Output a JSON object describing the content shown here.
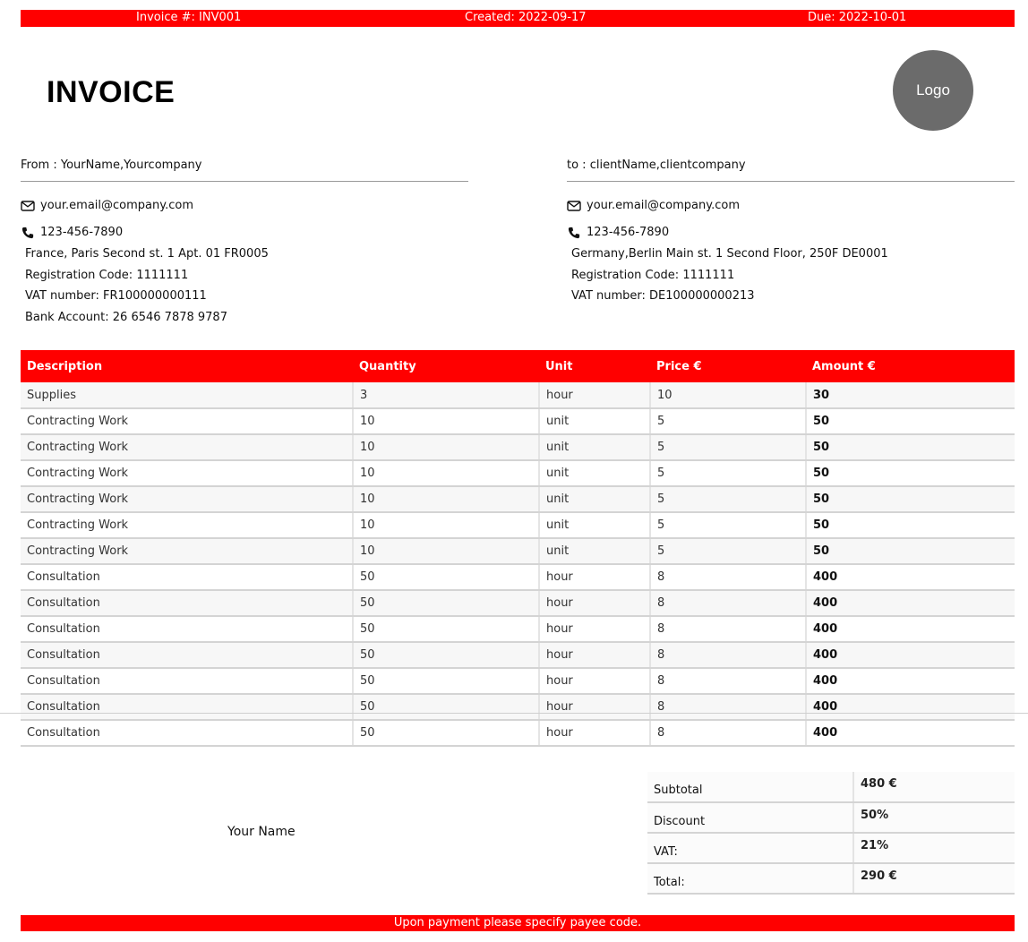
{
  "header_bar": {
    "invoice_number": "Invoice #: INV001",
    "created": "Created: 2022-09-17",
    "due": "Due: 2022-10-01"
  },
  "title": "INVOICE",
  "logo_text": "Logo",
  "from": {
    "heading": "From : YourName,Yourcompany",
    "email": "your.email@company.com",
    "phone": "123-456-7890",
    "address": "France, Paris Second st. 1 Apt. 01 FR0005",
    "registration": "Registration Code: 1111111",
    "vat": "VAT number: FR100000000111",
    "bank": "Bank Account: 26 6546 7878 9787"
  },
  "to": {
    "heading": "to : clientName,clientcompany",
    "email": "your.email@company.com",
    "phone": "123-456-7890",
    "address": "Germany,Berlin Main st. 1 Second Floor, 250F DE0001",
    "registration": "Registration Code: 1111111",
    "vat": "VAT number: DE100000000213"
  },
  "items_table": {
    "headers": [
      "Description",
      "Quantity",
      "Unit",
      "Price €",
      "Amount €"
    ],
    "rows": [
      [
        "Supplies",
        "3",
        "hour",
        "10",
        "30"
      ],
      [
        "Contracting Work",
        "10",
        "unit",
        "5",
        "50"
      ],
      [
        "Contracting Work",
        "10",
        "unit",
        "5",
        "50"
      ],
      [
        "Contracting Work",
        "10",
        "unit",
        "5",
        "50"
      ],
      [
        "Contracting Work",
        "10",
        "unit",
        "5",
        "50"
      ],
      [
        "Contracting Work",
        "10",
        "unit",
        "5",
        "50"
      ],
      [
        "Contracting Work",
        "10",
        "unit",
        "5",
        "50"
      ],
      [
        "Consultation",
        "50",
        "hour",
        "8",
        "400"
      ],
      [
        "Consultation",
        "50",
        "hour",
        "8",
        "400"
      ],
      [
        "Consultation",
        "50",
        "hour",
        "8",
        "400"
      ],
      [
        "Consultation",
        "50",
        "hour",
        "8",
        "400"
      ],
      [
        "Consultation",
        "50",
        "hour",
        "8",
        "400"
      ],
      [
        "Consultation",
        "50",
        "hour",
        "8",
        "400"
      ],
      [
        "Consultation",
        "50",
        "hour",
        "8",
        "400"
      ]
    ]
  },
  "signature_name": "Your Name",
  "totals": [
    {
      "label": "Subtotal",
      "value": "480 €"
    },
    {
      "label": "Discount",
      "value": "50%"
    },
    {
      "label": "VAT:",
      "value": "21%"
    },
    {
      "label": "Total:",
      "value": "290 €"
    }
  ],
  "footer_text": "Upon payment please specify payee code.",
  "colors": {
    "accent": "#ff0000",
    "logo_bg": "#6b6b6b"
  },
  "icons": {
    "email": "envelope-icon",
    "phone": "phone-icon"
  }
}
